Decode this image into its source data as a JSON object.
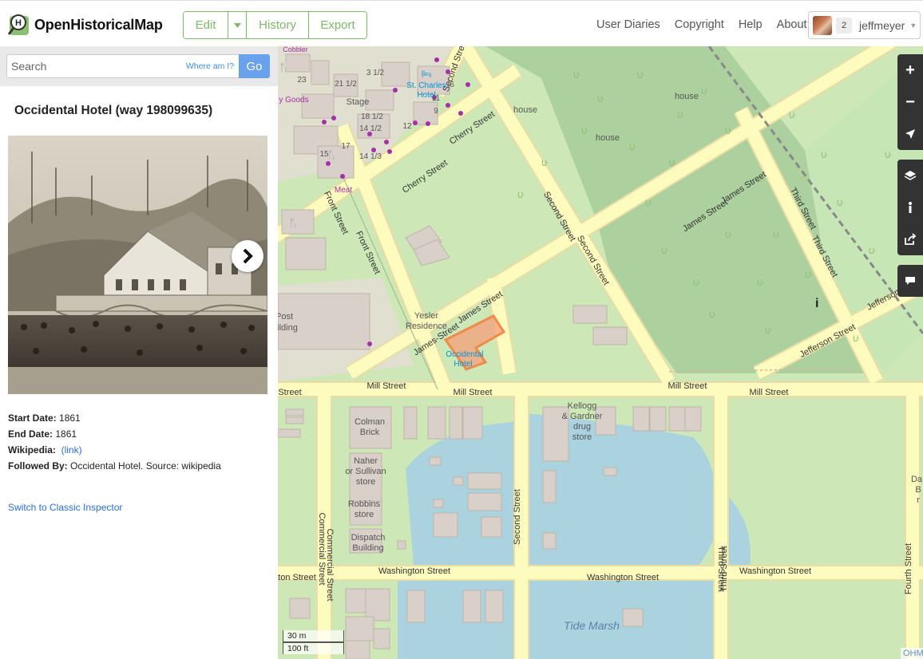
{
  "app": {
    "name": "OpenHistoricalMap"
  },
  "header": {
    "edit_label": "Edit",
    "history_label": "History",
    "export_label": "Export",
    "nav": [
      "User Diaries",
      "Copyright",
      "Help",
      "About"
    ],
    "user": {
      "message_count": "2",
      "username": "jeffmeyer"
    }
  },
  "search": {
    "placeholder": "Search",
    "where_am_i": "Where am I?",
    "go_label": "Go"
  },
  "feature": {
    "title": "Occidental Hotel (way 198099635)",
    "tags": [
      {
        "key": "Start Date:",
        "value": "1861"
      },
      {
        "key": "End Date:",
        "value": "1861"
      },
      {
        "key": "Wikipedia:",
        "value": "(link)"
      },
      {
        "key": "Followed By:",
        "value": "Occidental Hotel. Source: wikipedia"
      }
    ],
    "classic_inspector": "Switch to Classic Inspector"
  },
  "map": {
    "streets": {
      "cherry_1": "Cherry Street",
      "cherry_2": "Cherry Street",
      "second_1": "Second Street",
      "second_2": "Second Street",
      "second_3": "Second Street",
      "second_4": "Second Street",
      "front_1": "Front Street",
      "front_2": "Front Street",
      "james_1": "James Street",
      "james_2": "James Street",
      "james_3": "James Street",
      "james_4": "James-Street",
      "third_1": "Third Street",
      "third_2": "Third Street",
      "third_3": "Third Street",
      "third_4": "Third Street",
      "jefferson_1": "Jefferson Street",
      "jefferson_2": "Jefferson Stre",
      "mill_1": "Mill Street",
      "mill_2": "Mill Street",
      "mill_3": "Mill Street",
      "mill_4": "Mill Street",
      "mill_5": "Street",
      "washington_1": "Washington Street",
      "washington_2": "Washington Street",
      "washington_3": "Washington Street",
      "washington_4": "ton Street",
      "commercial_1": "Commercial Street",
      "commercial_2": "Commercial Street",
      "fourth": "Fourth Street"
    },
    "labels": {
      "cobbler": "Cobbler",
      "goods": "y Goods",
      "stage": "Stage",
      "meat": "Meat",
      "st_charles": "St. Charles",
      "hotel": "Hotel",
      "house_1": "house",
      "house_2": "house",
      "house_3": "house",
      "yesler": "Yesler",
      "residence": "Residence",
      "occidental": "Occidental",
      "occidental_hotel": "Hotel",
      "post": "Post",
      "ilding": "ilding",
      "colman": "Colman",
      "brick": "Brick",
      "naher": "Naher",
      "or_sullivan": "or Sullivan",
      "store_1": "store",
      "robbins": "Robbins",
      "store_2": "store",
      "dispatch": "Dispatch",
      "building": "Building",
      "kellogg": "Kellogg",
      "gardner": "& Gardner",
      "drug": "drug",
      "store_3": "store",
      "tide_marsh": "Tide Marsh",
      "da": "Da",
      "b": "B",
      "r": "r"
    },
    "house_numbers": [
      "23",
      "21 1/2",
      "3 1/2",
      "6",
      "18 1/2",
      "14 1/2",
      "14 1/3",
      "12",
      "9",
      "17",
      "11",
      "15"
    ],
    "scale_metric": "30 m",
    "scale_imperial": "100 ft",
    "attribution": "OHM"
  },
  "colors": {
    "accent": "#7eba6c",
    "go_button": "#6aa1ec",
    "link": "#2a6fd6",
    "road": "#fdfbbd",
    "road_casing": "#e9dca6",
    "park": "#cde8b6",
    "forest": "#add19e",
    "water": "#aad3df",
    "building": "#d9d0c9",
    "highlight": "#f08a4a"
  }
}
